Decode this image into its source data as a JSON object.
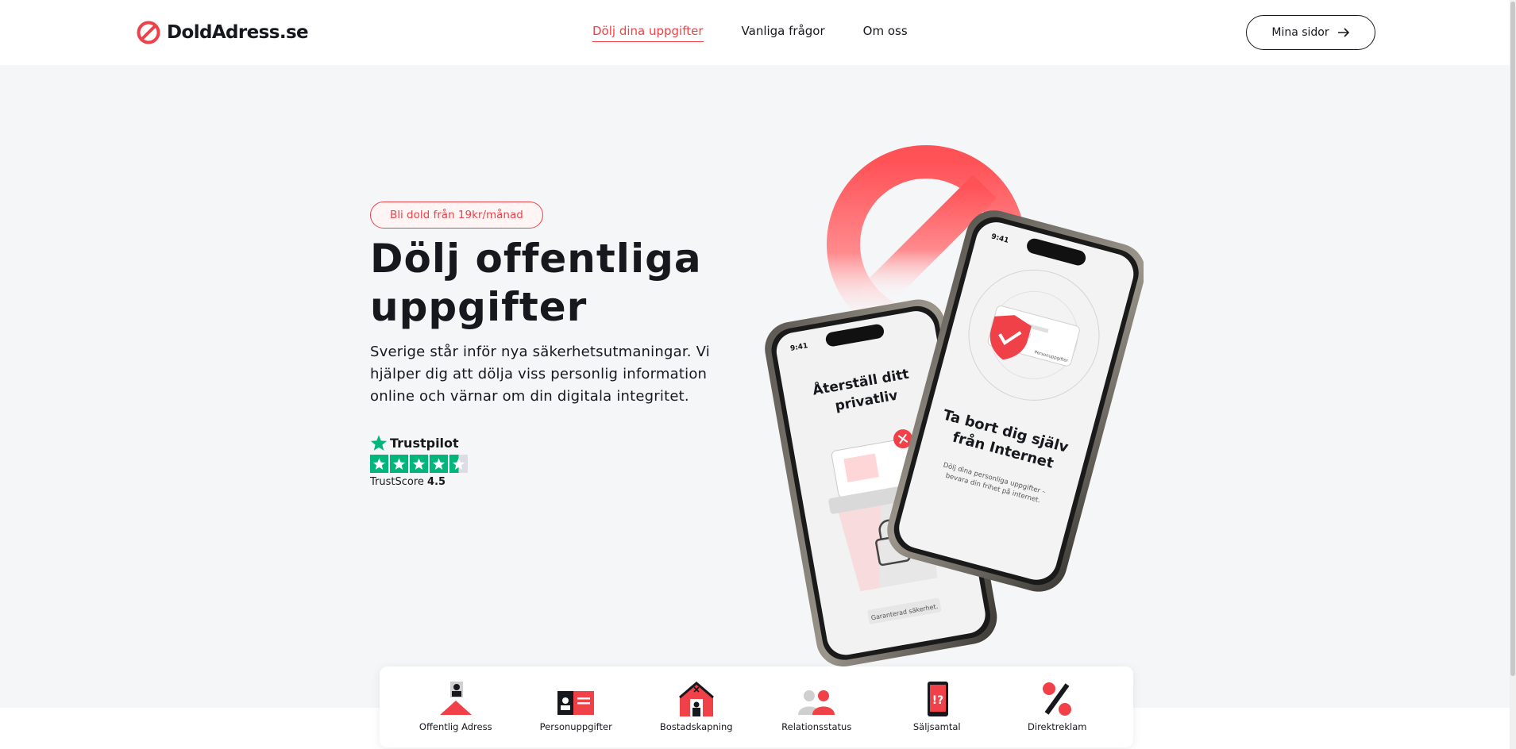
{
  "brand": {
    "name": "DoldAdress.se",
    "accent": "#ef4147"
  },
  "nav": {
    "items": [
      {
        "label": "Dölj dina uppgifter",
        "active": true
      },
      {
        "label": "Vanliga frågor",
        "active": false
      },
      {
        "label": "Om oss",
        "active": false
      }
    ],
    "account_button": "Mina sidor"
  },
  "hero": {
    "badge": "Bli dold från 19kr/månad",
    "title": "Dölj offentliga uppgifter",
    "lead": "Sverige står inför nya säkerhetsutmaningar. Vi hjälper dig att dölja viss personlig information online och värnar om din digitala integritet.",
    "trustpilot": {
      "brand": "Trustpilot",
      "score_label": "TrustScore",
      "score": "4.5",
      "stars": 4.5,
      "color": "#00b67a"
    }
  },
  "phones": {
    "left": {
      "time": "9:41",
      "title": "Återställ ditt privatliv",
      "footer": "Garanterad säkerhet."
    },
    "right": {
      "time": "9:41",
      "title": "Ta bort dig själv från Internet",
      "subtitle": "Dölj dina personliga uppgifter – bevara din frihet på internet.",
      "card_label": "Personuppgifter"
    }
  },
  "categories": [
    {
      "label": "Offentlig Adress",
      "icon": "public-address-icon"
    },
    {
      "label": "Personuppgifter",
      "icon": "personal-data-icon"
    },
    {
      "label": "Bostadskapning",
      "icon": "house-hijack-icon"
    },
    {
      "label": "Relationsstatus",
      "icon": "relationship-icon"
    },
    {
      "label": "Säljsamtal",
      "icon": "sales-call-icon"
    },
    {
      "label": "Direktreklam",
      "icon": "direct-ad-icon"
    }
  ]
}
